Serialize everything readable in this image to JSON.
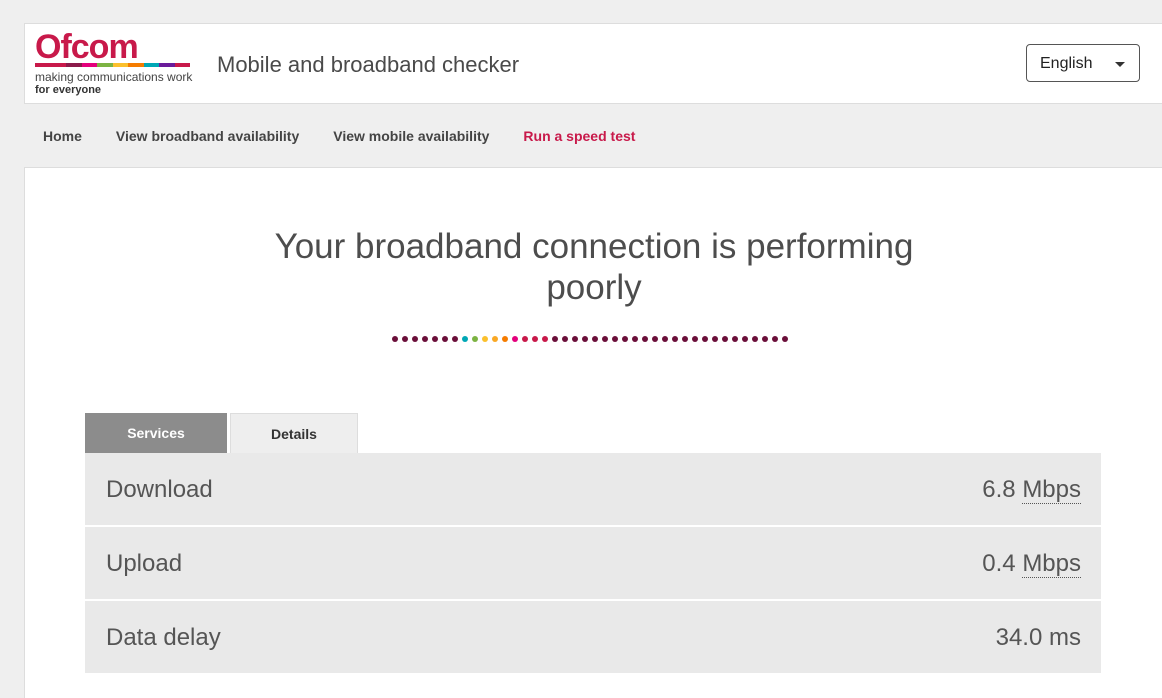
{
  "brand": {
    "logo_word": "Ofcom",
    "tagline_line1": "making communications work",
    "tagline_line2": "for everyone",
    "logo_color": "#c8194a",
    "bar_colors": [
      "#c8194a",
      "#c8194a",
      "#8b1a4a",
      "#e4007c",
      "#7cb342",
      "#fbc02d",
      "#f57c00",
      "#00a7b5",
      "#6a1b9a",
      "#c8194a"
    ]
  },
  "header": {
    "title": "Mobile and broadband checker"
  },
  "language": {
    "selected": "English"
  },
  "nav": {
    "items": [
      {
        "label": "Home",
        "active": false
      },
      {
        "label": "View broadband availability",
        "active": false
      },
      {
        "label": "View mobile availability",
        "active": false
      },
      {
        "label": "Run a speed test",
        "active": true
      }
    ]
  },
  "main": {
    "headline_line1": "Your broadband connection is performing",
    "headline_line2": "poorly",
    "dot_colors": [
      "#6b0f3a",
      "#6b0f3a",
      "#6b0f3a",
      "#6b0f3a",
      "#6b0f3a",
      "#6b0f3a",
      "#6b0f3a",
      "#00a7b5",
      "#7cb342",
      "#fbc02d",
      "#f9a825",
      "#f57c00",
      "#e4007c",
      "#c8194a",
      "#c8194a",
      "#c8194a",
      "#6b0f3a",
      "#6b0f3a",
      "#6b0f3a",
      "#6b0f3a",
      "#6b0f3a",
      "#6b0f3a",
      "#6b0f3a",
      "#6b0f3a",
      "#6b0f3a",
      "#6b0f3a",
      "#6b0f3a",
      "#6b0f3a",
      "#6b0f3a",
      "#6b0f3a",
      "#6b0f3a",
      "#6b0f3a",
      "#6b0f3a",
      "#6b0f3a",
      "#6b0f3a",
      "#6b0f3a",
      "#6b0f3a",
      "#6b0f3a",
      "#6b0f3a",
      "#6b0f3a"
    ],
    "tabs": [
      {
        "label": "Services",
        "active": true
      },
      {
        "label": "Details",
        "active": false
      }
    ],
    "results": [
      {
        "label": "Download",
        "value": "6.8",
        "unit": "Mbps"
      },
      {
        "label": "Upload",
        "value": "0.4",
        "unit": "Mbps"
      },
      {
        "label": "Data delay",
        "value": "34.0",
        "unit": "ms"
      }
    ]
  }
}
